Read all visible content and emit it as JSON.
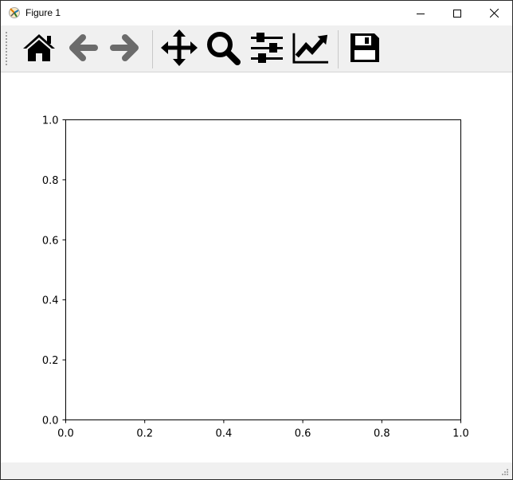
{
  "window": {
    "title": "Figure 1",
    "app_icon": "matplotlib-icon",
    "controls": [
      "minimize-icon",
      "maximize-icon",
      "close-icon"
    ]
  },
  "toolbar": {
    "tools": [
      {
        "name": "home",
        "icon": "home-icon"
      },
      {
        "name": "back",
        "icon": "arrow-left-icon",
        "enabled": false
      },
      {
        "name": "forward",
        "icon": "arrow-right-icon",
        "enabled": false
      },
      {
        "name": "pan",
        "icon": "move-icon"
      },
      {
        "name": "zoom",
        "icon": "magnifier-icon"
      },
      {
        "name": "subplots",
        "icon": "sliders-icon"
      },
      {
        "name": "customize",
        "icon": "line-chart-icon"
      },
      {
        "name": "save",
        "icon": "floppy-disk-icon"
      }
    ]
  },
  "chart_data": {
    "type": "line",
    "title": "",
    "xlabel": "",
    "ylabel": "",
    "xlim": [
      0.0,
      1.0
    ],
    "ylim": [
      0.0,
      1.0
    ],
    "xticks": [
      "0.0",
      "0.2",
      "0.4",
      "0.6",
      "0.8",
      "1.0"
    ],
    "yticks": [
      "0.0",
      "0.2",
      "0.4",
      "0.6",
      "0.8",
      "1.0"
    ],
    "series": [],
    "grid": false
  }
}
